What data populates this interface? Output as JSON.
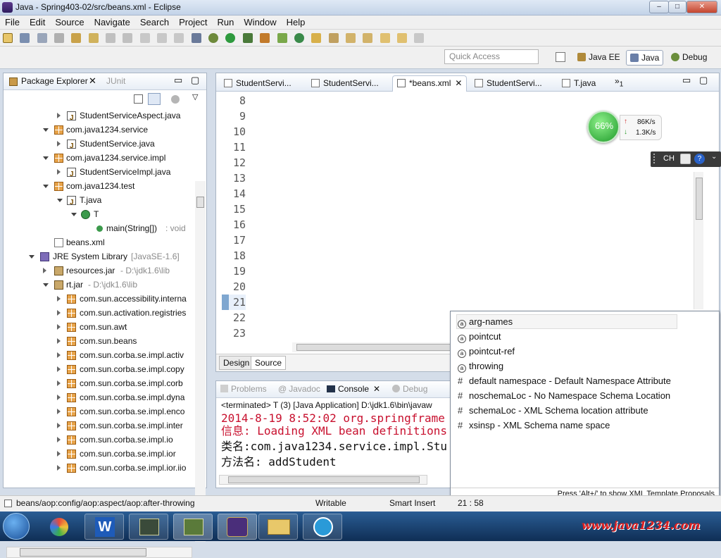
{
  "window": {
    "title": "Java - Spring403-02/src/beans.xml - Eclipse",
    "min": "–",
    "max": "□",
    "close": "✕"
  },
  "menu": [
    "File",
    "Edit",
    "Source",
    "Navigate",
    "Search",
    "Project",
    "Run",
    "Window",
    "Help"
  ],
  "quick_access": {
    "placeholder": "Quick Access"
  },
  "perspectives": [
    {
      "label": "Java EE"
    },
    {
      "label": "Java",
      "active": true
    },
    {
      "label": "Debug"
    }
  ],
  "package_explorer": {
    "tab": "Package Explorer",
    "other_tab": "JUnit",
    "tree": [
      {
        "label": "StudentServiceAspect.java",
        "icon": "java-file-icon"
      },
      {
        "label": "com.java1234.service",
        "icon": "package-icon"
      },
      {
        "label": "StudentService.java",
        "icon": "java-file-icon"
      },
      {
        "label": "com.java1234.service.impl",
        "icon": "package-icon"
      },
      {
        "label": "StudentServiceImpl.java",
        "icon": "java-file-icon"
      },
      {
        "label": "com.java1234.test",
        "icon": "package-icon"
      },
      {
        "label": "T.java",
        "icon": "java-file-icon"
      },
      {
        "label": "T",
        "icon": "class-icon"
      },
      {
        "label": "main(String[])",
        "suffix": " : void",
        "icon": "method-icon"
      },
      {
        "label": "beans.xml",
        "icon": "xml-file-icon"
      },
      {
        "label": "JRE System Library",
        "suffix": " [JavaSE-1.6]",
        "icon": "library-icon"
      },
      {
        "label": "resources.jar",
        "suffix": " - D:\\jdk1.6\\lib",
        "icon": "jar-icon"
      },
      {
        "label": "rt.jar",
        "suffix": " - D:\\jdk1.6\\lib",
        "icon": "jar-icon"
      },
      {
        "label": "com.sun.accessibility.interna",
        "icon": "package-icon"
      },
      {
        "label": "com.sun.activation.registries",
        "icon": "package-icon"
      },
      {
        "label": "com.sun.awt",
        "icon": "package-icon"
      },
      {
        "label": "com.sun.beans",
        "icon": "package-icon"
      },
      {
        "label": "com.sun.corba.se.impl.activ",
        "icon": "package-icon"
      },
      {
        "label": "com.sun.corba.se.impl.copy",
        "icon": "package-icon"
      },
      {
        "label": "com.sun.corba.se.impl.corb",
        "icon": "package-icon"
      },
      {
        "label": "com.sun.corba.se.impl.dyna",
        "icon": "package-icon"
      },
      {
        "label": "com.sun.corba.se.impl.enco",
        "icon": "package-icon"
      },
      {
        "label": "com.sun.corba.se.impl.inter",
        "icon": "package-icon"
      },
      {
        "label": "com.sun.corba.se.impl.io",
        "icon": "package-icon"
      },
      {
        "label": "com.sun.corba.se.impl.ior",
        "icon": "package-icon"
      },
      {
        "label": "com.sun.corba.se.impl.ior.iio",
        "icon": "package-icon"
      }
    ]
  },
  "editor": {
    "tabs": [
      {
        "label": "StudentServi...",
        "active": false
      },
      {
        "label": "StudentServi...",
        "active": false
      },
      {
        "label": "*beans.xml",
        "active": true
      },
      {
        "label": "StudentServi...",
        "active": false
      },
      {
        "label": "T.java",
        "active": false
      }
    ],
    "overflow_count": "1",
    "line_numbers": [
      "8",
      "9",
      "10",
      "11",
      "12",
      "13",
      "14",
      "15",
      "16",
      "17",
      "18",
      "19",
      "20",
      "21",
      "22",
      "23"
    ],
    "bottom_tabs": [
      "Design",
      "Source"
    ]
  },
  "console": {
    "tabs": [
      "Problems",
      "Javadoc",
      "Console",
      "Debug"
    ],
    "terminated": "<terminated> T (3) [Java Application] D:\\jdk1.6\\bin\\javaw",
    "lines": [
      {
        "text": "2014-8-19 8:52:02 org.springframe",
        "color": "red"
      },
      {
        "text": "信息: Loading XML bean definitions",
        "color": "red"
      },
      {
        "text": "类名:com.java1234.service.impl.Stu",
        "color": "black"
      },
      {
        "text": "方法名: addStudent",
        "color": "black"
      }
    ]
  },
  "content_assist": {
    "items": [
      {
        "label": "arg-names",
        "kind": "attribute"
      },
      {
        "label": "pointcut",
        "kind": "attribute"
      },
      {
        "label": "pointcut-ref",
        "kind": "attribute"
      },
      {
        "label": "throwing",
        "kind": "attribute"
      },
      {
        "label": "default namespace - Default Namespace Attribute",
        "kind": "namespace"
      },
      {
        "label": "noschemaLoc - No Namespace Schema Location",
        "kind": "namespace"
      },
      {
        "label": "schemaLoc - XML Schema location attribute",
        "kind": "namespace"
      },
      {
        "label": "xsinsp - XML Schema name space",
        "kind": "namespace"
      }
    ],
    "footer": "Press 'Alt+/' to show XML Template Proposals"
  },
  "status": {
    "path": "beans/aop:config/aop:aspect/aop:after-throwing",
    "writable": "Writable",
    "insert": "Smart Insert",
    "position": "21 : 58"
  },
  "speed_widget": {
    "percent": "66%",
    "up": "86K/s",
    "down": "1.3K/s"
  },
  "ime_bar": {
    "label": "CH"
  },
  "watermark": "www.java1234.com",
  "colors": {
    "accent": "#3f7f7f",
    "string": "#2a00ff",
    "attr": "#7f007f",
    "console_red": "#c8102e"
  }
}
